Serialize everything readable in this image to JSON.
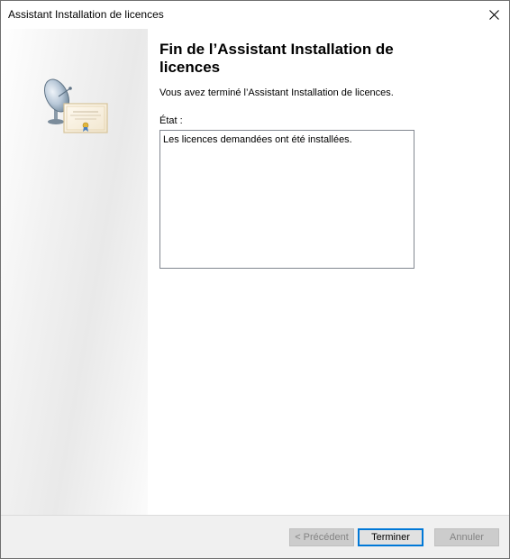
{
  "window": {
    "title": "Assistant Installation de licences"
  },
  "icons": {
    "close": "close-icon",
    "wizard_art": "satellite-dish-certificate-icon"
  },
  "main": {
    "heading": "Fin de l’Assistant Installation de licences",
    "description": "Vous avez terminé l’Assistant Installation de licences.",
    "status_label": "État :",
    "status_text": "Les licences demandées ont été installées."
  },
  "buttons": {
    "previous": "< Précédent",
    "finish": "Terminer",
    "cancel": "Annuler"
  },
  "colors": {
    "accent": "#0078d7",
    "footer_bg": "#f0f0f0",
    "disabled_bg": "#cccccc",
    "disabled_text": "#838383"
  }
}
